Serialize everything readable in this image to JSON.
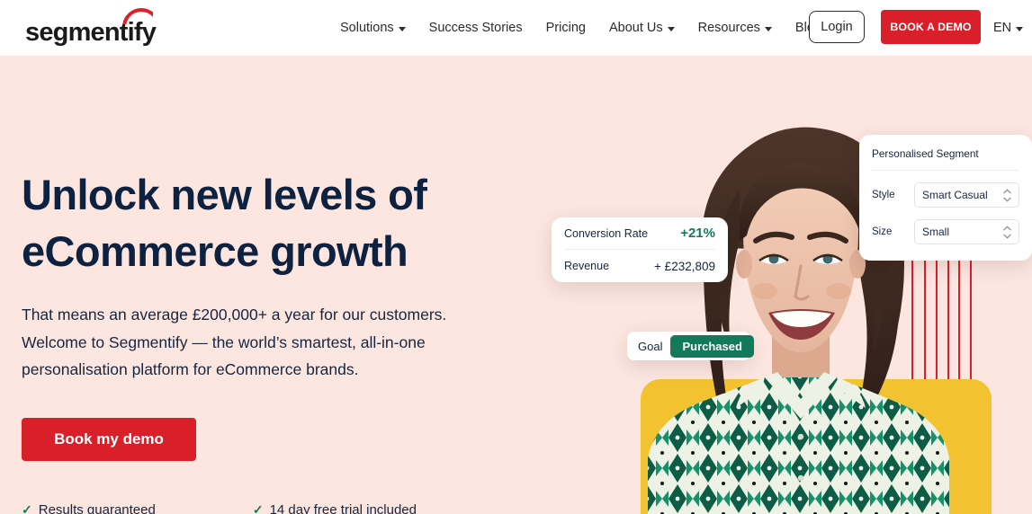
{
  "brand": {
    "logo_text": "segmentify",
    "accent_red": "#d81f2a",
    "accent_green": "#13795b",
    "accent_yellow": "#f2c230",
    "navy": "#0d2240",
    "hero_bg": "#fde6e0"
  },
  "header": {
    "nav": [
      {
        "label": "Solutions",
        "has_dropdown": true
      },
      {
        "label": "Success Stories",
        "has_dropdown": false
      },
      {
        "label": "Pricing",
        "has_dropdown": false
      },
      {
        "label": "About Us",
        "has_dropdown": true
      },
      {
        "label": "Resources",
        "has_dropdown": true
      },
      {
        "label": "Blog",
        "has_dropdown": false
      }
    ],
    "login_label": "Login",
    "demo_label": "BOOK A DEMO",
    "language": "EN"
  },
  "hero": {
    "headline_line1": "Unlock new levels of",
    "headline_line2": "eCommerce growth",
    "subcopy": "That means an average £200,000+ a year for our customers. Welcome to Segmentify — the world’s smartest, all-in-one personalisation platform for eCommerce brands.",
    "cta_label": "Book my demo",
    "ticks": [
      {
        "mark": "✓",
        "label": "Results guaranteed"
      },
      {
        "mark": "✓",
        "label": "14 day free trial included"
      }
    ]
  },
  "cards": {
    "stats": {
      "rows": [
        {
          "label": "Conversion Rate",
          "value": "+21%"
        },
        {
          "label": "Revenue",
          "value": "+ £232,809"
        }
      ]
    },
    "goal": {
      "label": "Goal",
      "status": "Purchased"
    },
    "segment": {
      "title": "Personalised Segment",
      "fields": [
        {
          "label": "Style",
          "value": "Smart Casual"
        },
        {
          "label": "Size",
          "value": "Small"
        }
      ]
    }
  }
}
